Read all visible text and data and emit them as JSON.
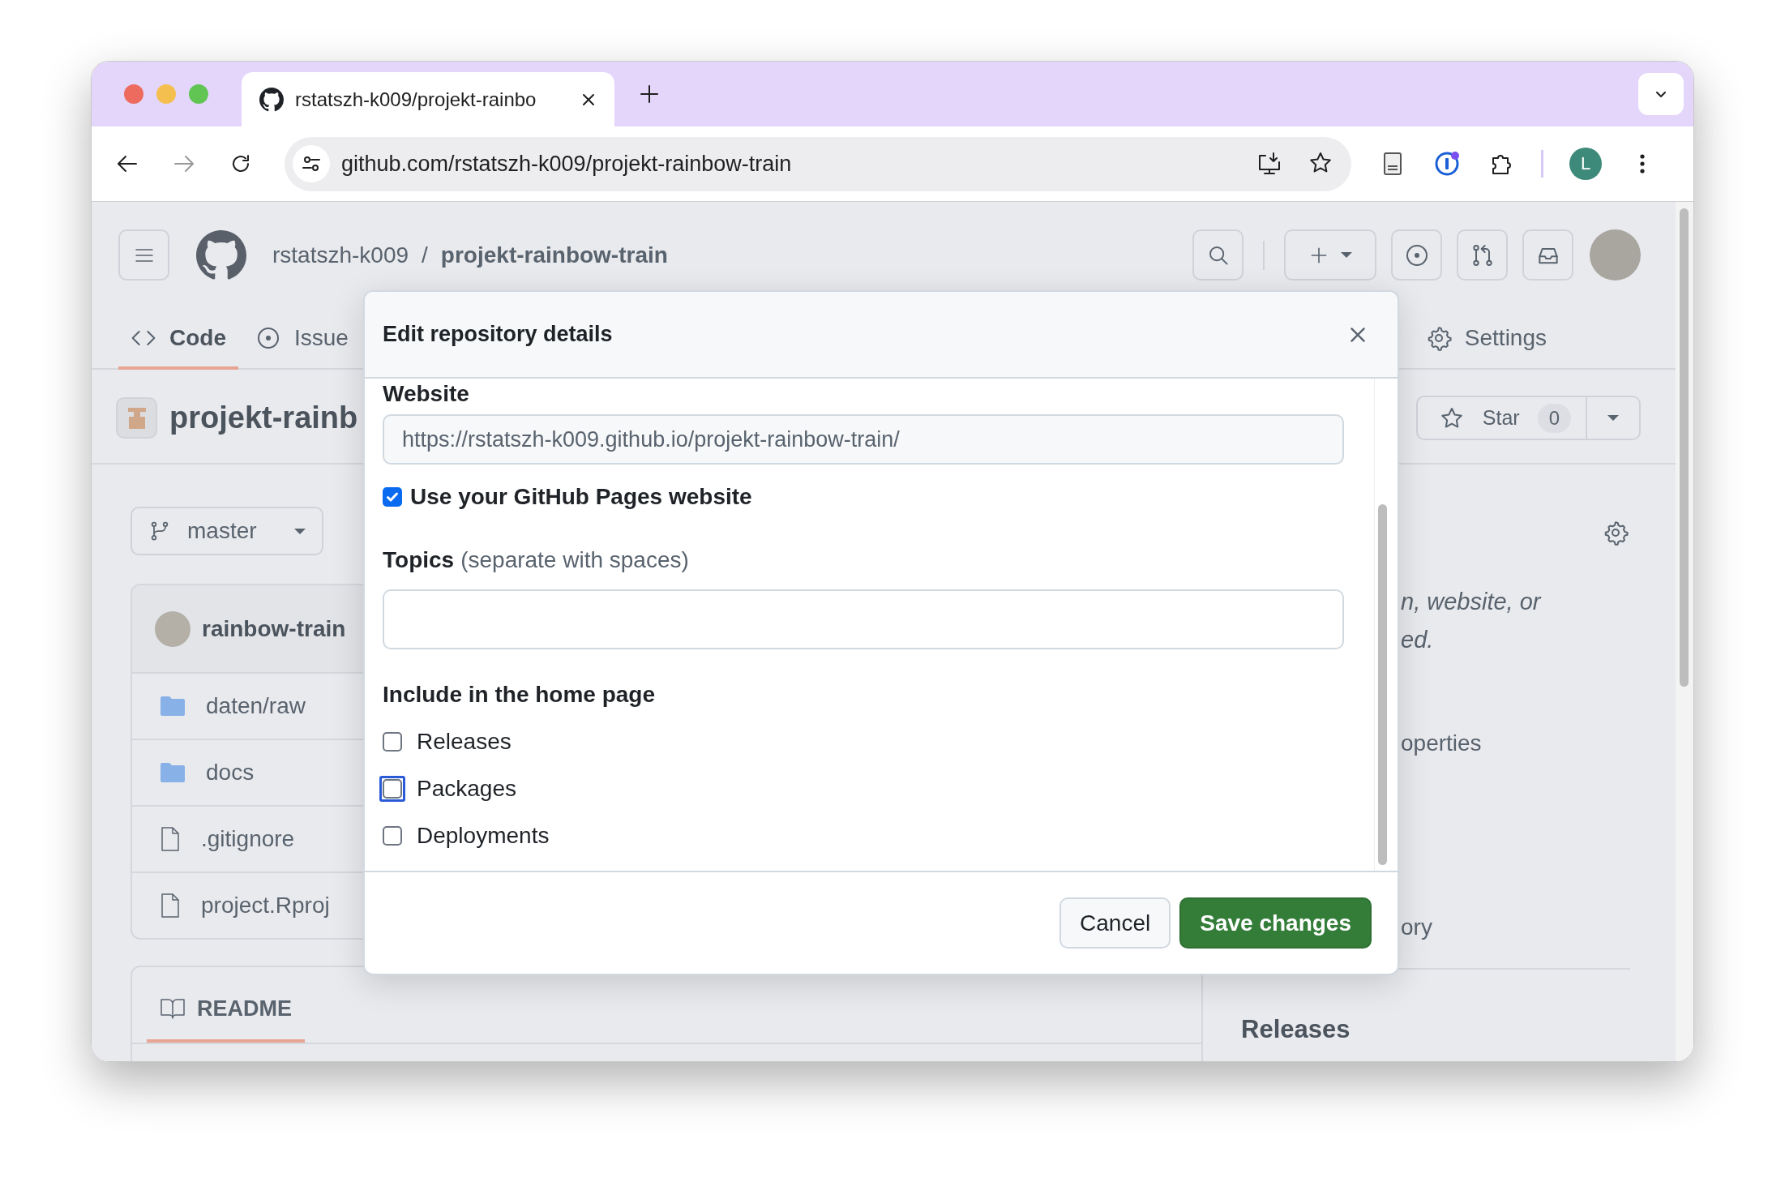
{
  "browser": {
    "tab": {
      "title": "rstatszh-k009/projekt-rainbo"
    },
    "address": "github.com/rstatszh-k009/projekt-rainbow-train",
    "profile": "L"
  },
  "header": {
    "owner": "rstatszh-k009",
    "separator": "/",
    "repo": "projekt-rainbow-train"
  },
  "nav_tabs": [
    {
      "label": "Code",
      "selected": true
    },
    {
      "label": "Issue",
      "selected": false
    }
  ],
  "nav_tabs_right": [
    {
      "label": "Settings",
      "selected": false
    }
  ],
  "repo_title": "projekt-rainb",
  "star": {
    "label": "Star",
    "count": "0"
  },
  "branch": "master",
  "files": {
    "owner": "rainbow-train",
    "entries": [
      {
        "name": "daten/raw",
        "kind": "folder"
      },
      {
        "name": "docs",
        "kind": "folder"
      },
      {
        "name": ".gitignore",
        "kind": "file"
      },
      {
        "name": "project.Rproj",
        "kind": "file"
      }
    ]
  },
  "readme_tab": {
    "label": "README",
    "selected": true
  },
  "sidebar": {
    "about_lines": [
      "n, website, or",
      "ed."
    ],
    "links": [
      "operties",
      "ory"
    ],
    "releases_heading": "Releases"
  },
  "dialog": {
    "title": "Edit repository details",
    "website": {
      "label": "Website",
      "value": "https://rstatszh-k009.github.io/projekt-rainbow-train/"
    },
    "use_pages": {
      "label": "Use your GitHub Pages website",
      "checked": true
    },
    "topics": {
      "label": "Topics",
      "hint": "(separate with spaces)"
    },
    "home_page": {
      "heading": "Include in the home page",
      "options": [
        {
          "label": "Releases",
          "checked": false,
          "focused": false
        },
        {
          "label": "Packages",
          "checked": false,
          "focused": true
        },
        {
          "label": "Deployments",
          "checked": false,
          "focused": false
        }
      ]
    },
    "buttons": [
      {
        "label": "Cancel",
        "kind": "secondary"
      },
      {
        "label": "Save changes",
        "kind": "primary"
      }
    ]
  }
}
